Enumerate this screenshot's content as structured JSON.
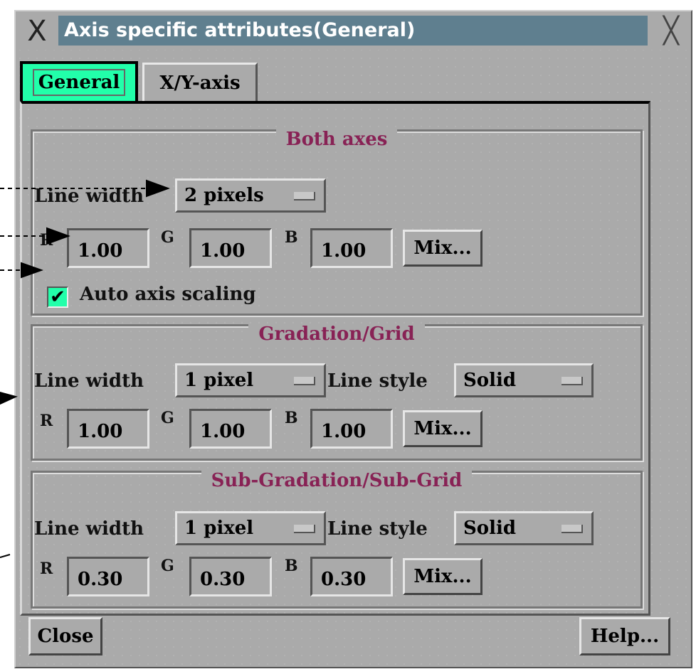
{
  "window": {
    "title": "Axis specific attributes(General)",
    "close_glyph": "╳",
    "x_logo": "X"
  },
  "tabs": [
    {
      "label": "General",
      "active": true
    },
    {
      "label": "X/Y-axis",
      "active": false
    }
  ],
  "both_axes": {
    "title": "Both axes",
    "line_width_label": "Line width",
    "line_width_value": "2 pixels",
    "r_label": "R",
    "r_value": "1.00",
    "g_label": "G",
    "g_value": "1.00",
    "b_label": "B",
    "b_value": "1.00",
    "mix_label": "Mix...",
    "auto_scaling_label": "Auto axis scaling",
    "auto_scaling_checked": true
  },
  "gradation": {
    "title": "Gradation/Grid",
    "line_width_label": "Line width",
    "line_width_value": "1 pixel",
    "line_style_label": "Line style",
    "line_style_value": "Solid",
    "r_label": "R",
    "r_value": "1.00",
    "g_label": "G",
    "g_value": "1.00",
    "b_label": "B",
    "b_value": "1.00",
    "mix_label": "Mix..."
  },
  "sub_gradation": {
    "title": "Sub-Gradation/Sub-Grid",
    "line_width_label": "Line width",
    "line_width_value": "1 pixel",
    "line_style_label": "Line style",
    "line_style_value": "Solid",
    "r_label": "R",
    "r_value": "0.30",
    "g_label": "G",
    "g_value": "0.30",
    "b_label": "B",
    "b_value": "0.30",
    "mix_label": "Mix..."
  },
  "footer": {
    "close_label": "Close",
    "help_label": "Help..."
  },
  "colors": {
    "window_bg": "#aaaaaa",
    "title_bg": "#5f7f8f",
    "active_tab": "#22ffaa",
    "group_title": "#882255"
  }
}
